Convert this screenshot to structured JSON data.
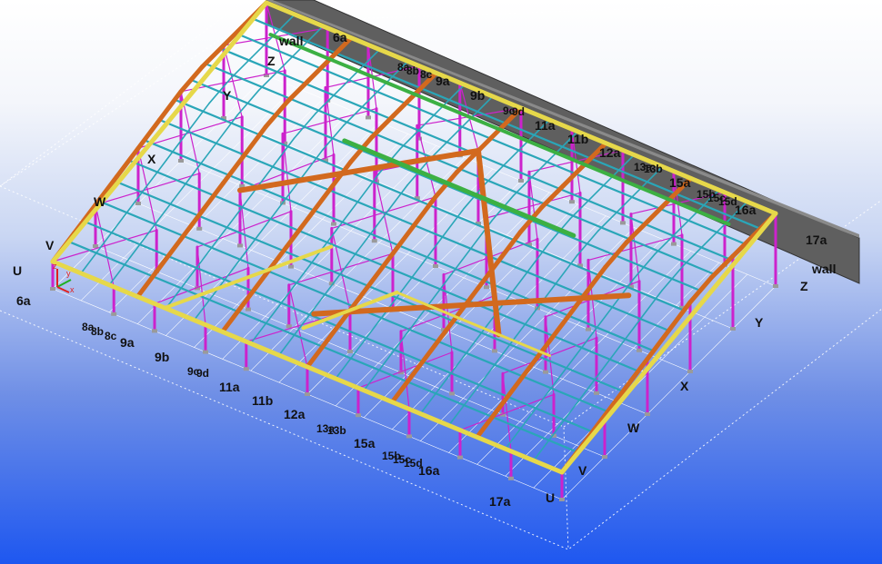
{
  "view": {
    "colors": {
      "sky_top": "#ffffff",
      "sky_bottom": "#1e57f0",
      "wall": "#5f5f5f",
      "column": "#cc22cc",
      "purlin": "#2aa6b8",
      "rafter": "#d2691e",
      "ridge": "#3cb043",
      "edge_beam": "#e6d84a",
      "grid_box": "#ffffff"
    },
    "icons": [
      "coordinate-axes-icon"
    ]
  },
  "grid_labels": {
    "letters_left": [
      "Z",
      "Y",
      "X",
      "W",
      "V",
      "U"
    ],
    "letters_right": [
      "Z",
      "Y",
      "X",
      "W",
      "V",
      "U"
    ],
    "wall_left": "wall",
    "wall_right": "wall",
    "front_axes": [
      "6a",
      "8a",
      "8b",
      "8c",
      "9a",
      "9b",
      "9c",
      "9d",
      "11a",
      "11b",
      "12a",
      "13a",
      "13b",
      "15a",
      "15b",
      "15c",
      "15d",
      "16a",
      "17a"
    ],
    "back_axes": [
      "6a",
      "8a",
      "8b",
      "8c",
      "9a",
      "9b",
      "9c",
      "9d",
      "11a",
      "11b",
      "12a",
      "13a",
      "13b",
      "15a",
      "15b",
      "15c",
      "15d",
      "16a",
      "17a"
    ]
  },
  "axes_icon": {
    "x": "x",
    "y": "y",
    "z": "z"
  }
}
